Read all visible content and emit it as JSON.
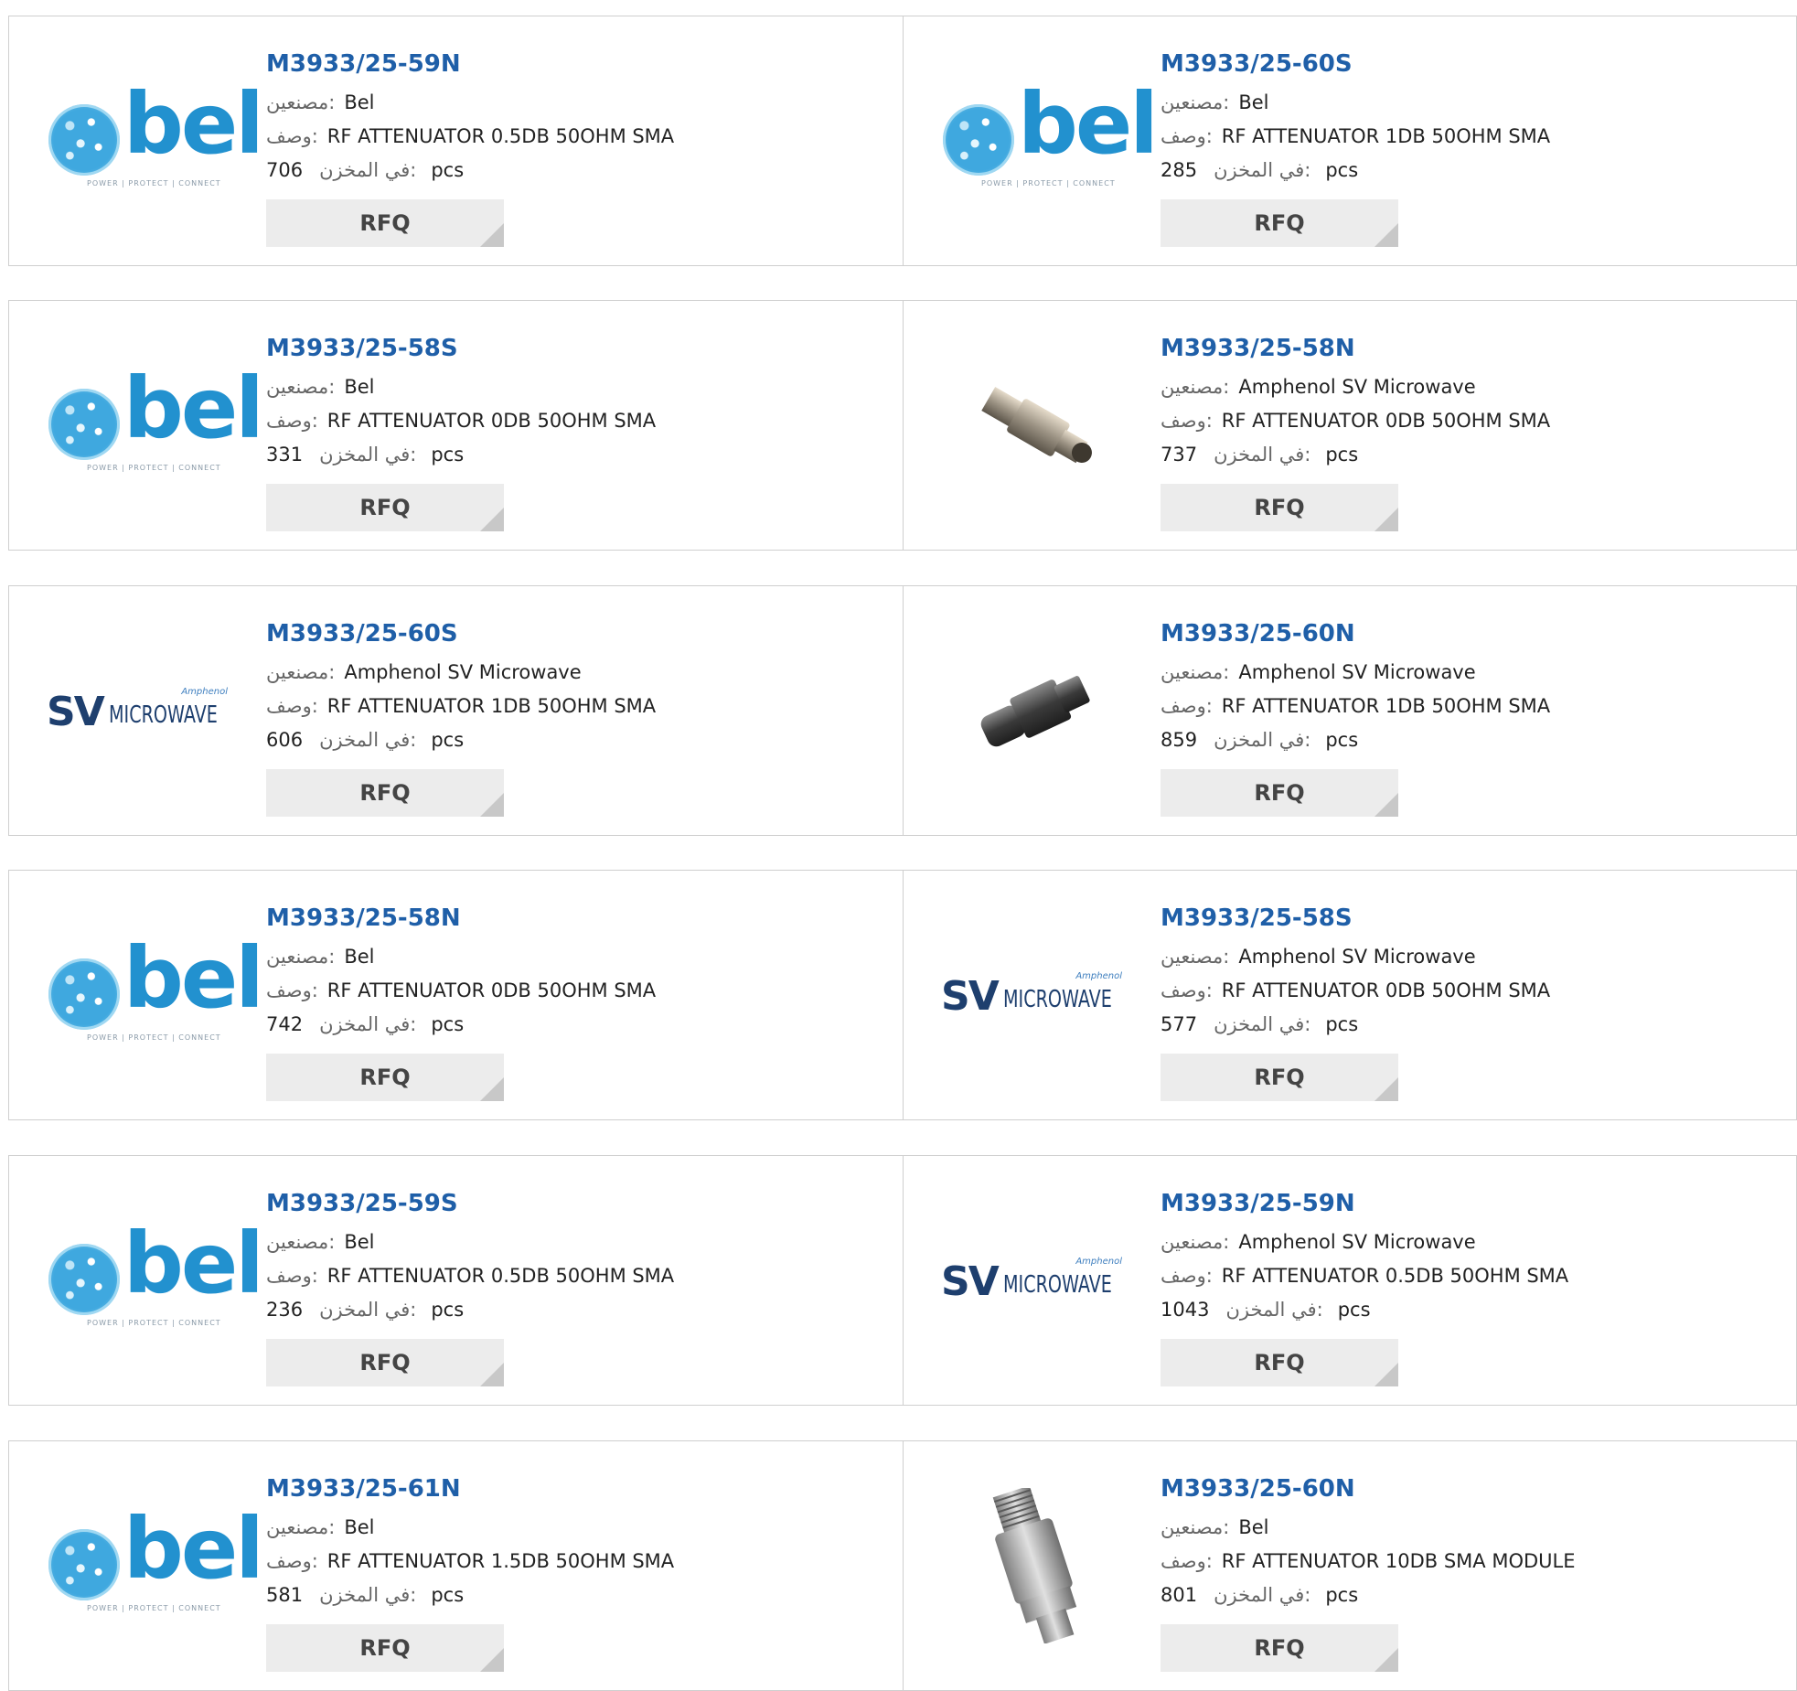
{
  "labels": {
    "manufacturer": "مصنعين:",
    "description": "وصف:",
    "stock": "في المخزن:",
    "unit": "pcs",
    "rfq": "RFQ"
  },
  "rows": [
    [
      {
        "part_number": "M3933/25-59N",
        "manufacturer": "Bel",
        "description": "RF ATTENUATOR 0.5DB 50OHM SMA",
        "stock": "706",
        "image": "bel-logo"
      },
      {
        "part_number": "M3933/25-60S",
        "manufacturer": "Bel",
        "description": "RF ATTENUATOR 1DB 50OHM SMA",
        "stock": "285",
        "image": "bel-logo"
      }
    ],
    [
      {
        "part_number": "M3933/25-58S",
        "manufacturer": "Bel",
        "description": "RF ATTENUATOR 0DB 50OHM SMA",
        "stock": "331",
        "image": "bel-logo"
      },
      {
        "part_number": "M3933/25-58N",
        "manufacturer": "Amphenol SV Microwave",
        "description": "RF ATTENUATOR 0DB 50OHM SMA",
        "stock": "737",
        "image": "attenuator-photo-silver"
      }
    ],
    [
      {
        "part_number": "M3933/25-60S",
        "manufacturer": "Amphenol SV Microwave",
        "description": "RF ATTENUATOR 1DB 50OHM SMA",
        "stock": "606",
        "image": "sv-microwave-logo"
      },
      {
        "part_number": "M3933/25-60N",
        "manufacturer": "Amphenol SV Microwave",
        "description": "RF ATTENUATOR 1DB 50OHM SMA",
        "stock": "859",
        "image": "attenuator-photo-dark"
      }
    ],
    [
      {
        "part_number": "M3933/25-58N",
        "manufacturer": "Bel",
        "description": "RF ATTENUATOR 0DB 50OHM SMA",
        "stock": "742",
        "image": "bel-logo"
      },
      {
        "part_number": "M3933/25-58S",
        "manufacturer": "Amphenol SV Microwave",
        "description": "RF ATTENUATOR 0DB 50OHM SMA",
        "stock": "577",
        "image": "sv-microwave-logo"
      }
    ],
    [
      {
        "part_number": "M3933/25-59S",
        "manufacturer": "Bel",
        "description": "RF ATTENUATOR 0.5DB 50OHM SMA",
        "stock": "236",
        "image": "bel-logo"
      },
      {
        "part_number": "M3933/25-59N",
        "manufacturer": "Amphenol SV Microwave",
        "description": "RF ATTENUATOR 0.5DB 50OHM SMA",
        "stock": "1043",
        "image": "sv-microwave-logo"
      }
    ],
    [
      {
        "part_number": "M3933/25-61N",
        "manufacturer": "Bel",
        "description": "RF ATTENUATOR 1.5DB 50OHM SMA",
        "stock": "581",
        "image": "bel-logo"
      },
      {
        "part_number": "M3933/25-60N",
        "manufacturer": "Bel",
        "description": "RF ATTENUATOR 10DB SMA MODULE",
        "stock": "801",
        "image": "attenuator-photo-closeup"
      }
    ]
  ],
  "logos": {
    "bel_text": "bel",
    "bel_tagline": "POWER | PROTECT | CONNECT",
    "sv_text": "SV",
    "microwave_text": "MICROWAVE",
    "amphenol_text": "Amphenol"
  },
  "colors": {
    "part_number": "#1f5fa8",
    "rfq_bg": "#ececec",
    "border": "#cfcfcf",
    "bel_blue": "#2291cf",
    "sv_navy": "#1e3f6e"
  }
}
